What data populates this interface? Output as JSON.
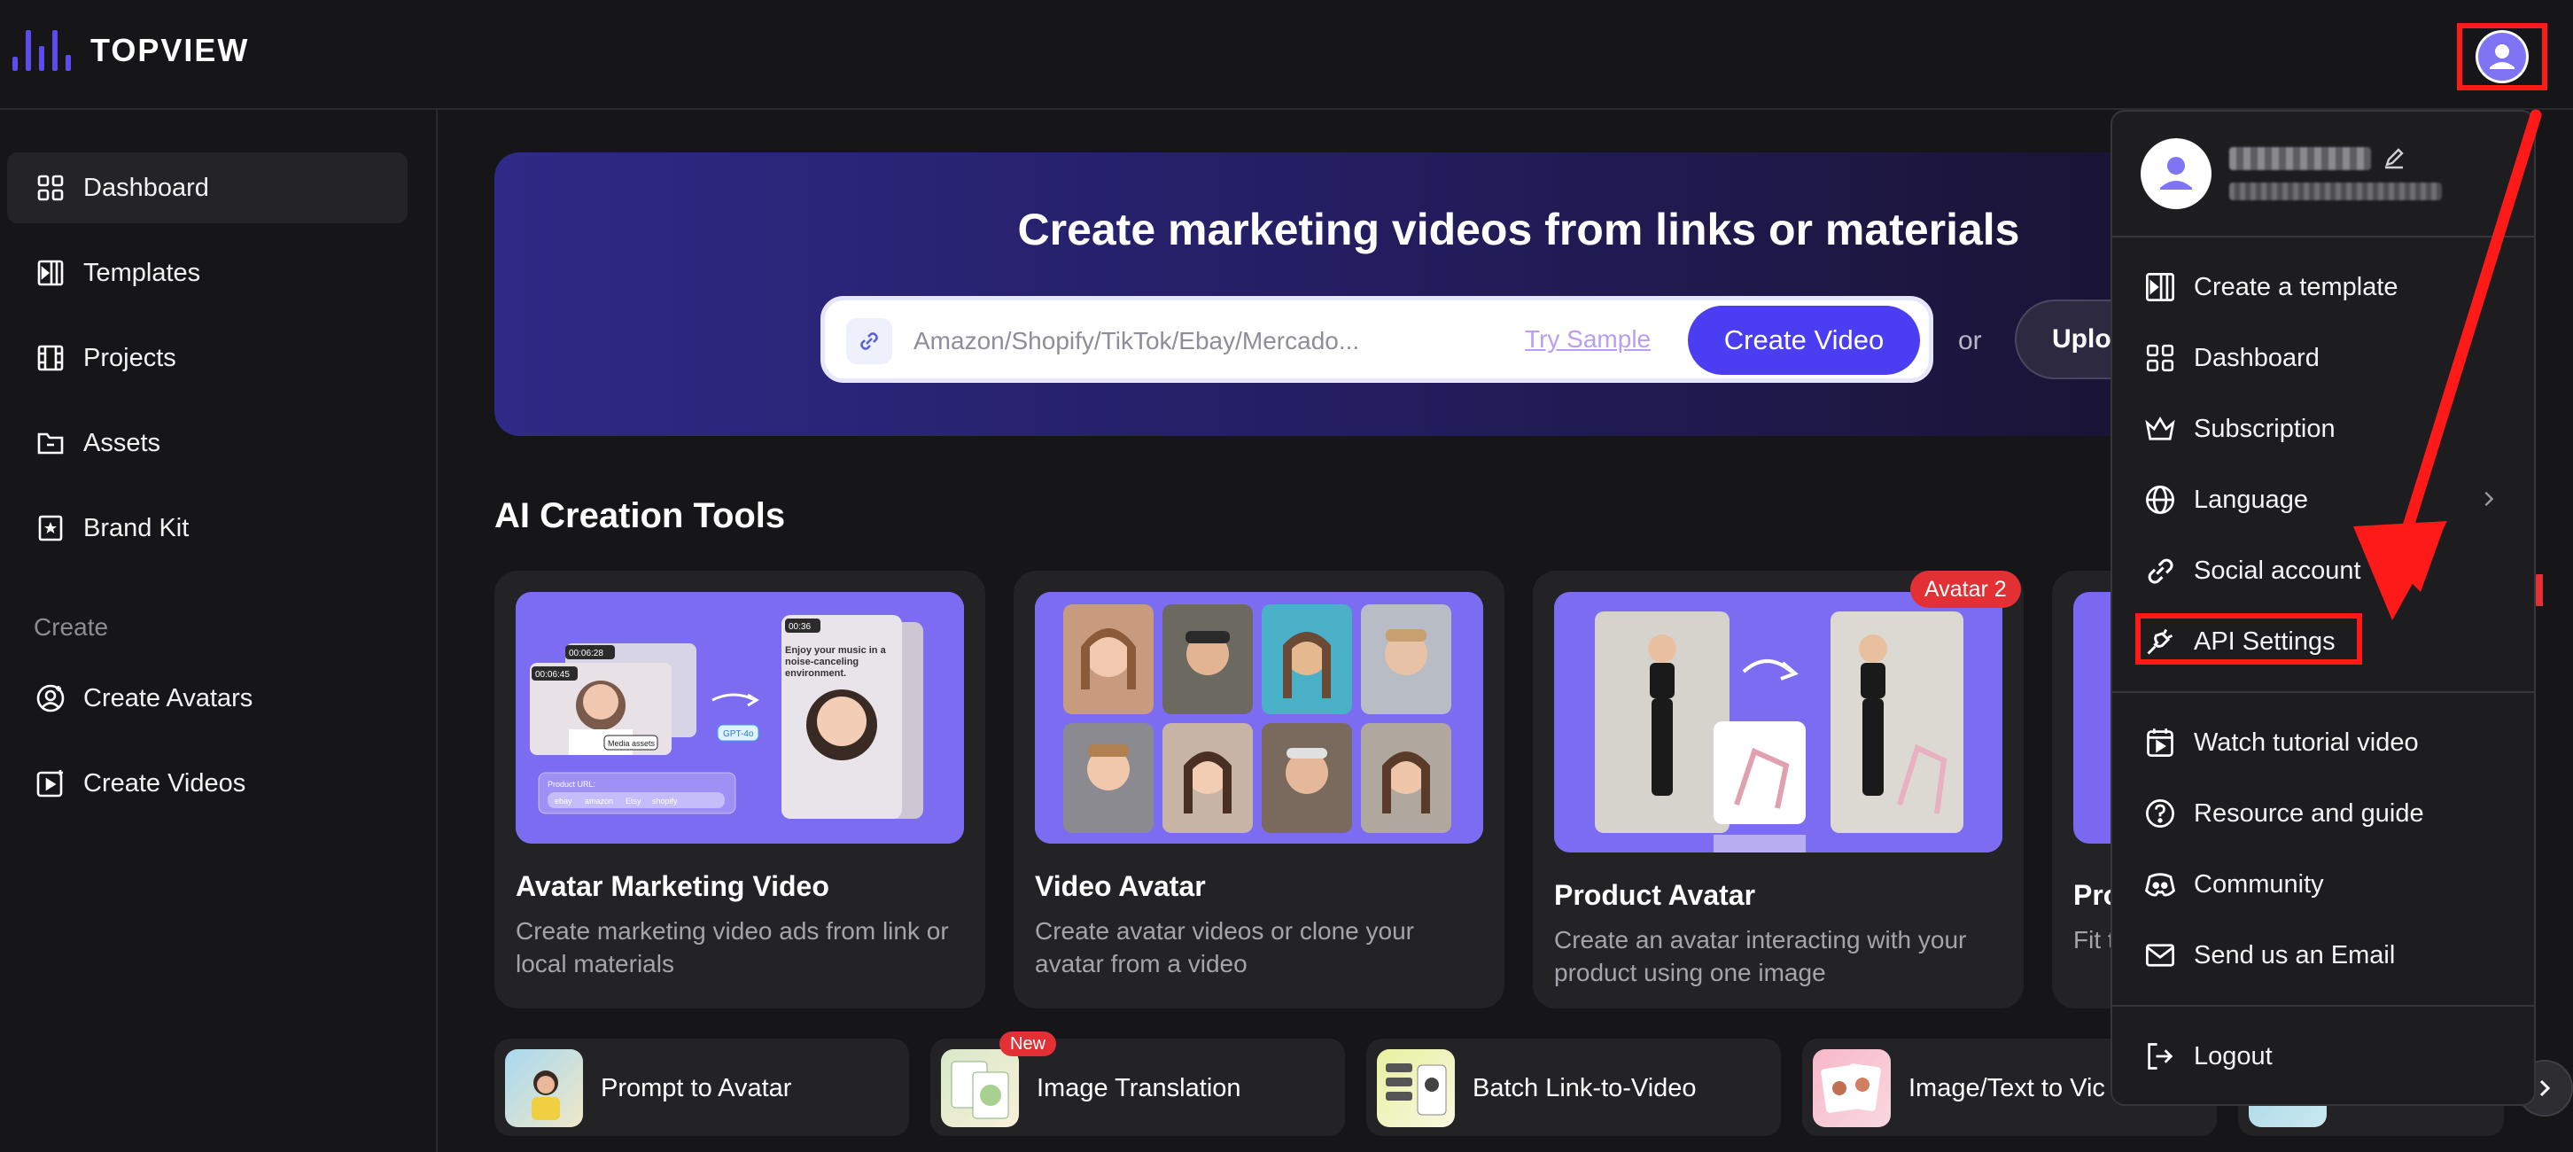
{
  "app": {
    "logo_text": "TOPVIEW"
  },
  "sidebar": {
    "items": [
      {
        "label": "Dashboard",
        "icon": "grid-icon"
      },
      {
        "label": "Templates",
        "icon": "template-icon"
      },
      {
        "label": "Projects",
        "icon": "film-icon"
      },
      {
        "label": "Assets",
        "icon": "folder-icon"
      },
      {
        "label": "Brand Kit",
        "icon": "bookmark-star-icon"
      }
    ],
    "section_create": "Create",
    "create_items": [
      {
        "label": "Create Avatars",
        "icon": "user-add-icon"
      },
      {
        "label": "Create Videos",
        "icon": "video-add-icon"
      }
    ]
  },
  "hero": {
    "title": "Create marketing videos from links or materials",
    "search_placeholder": "Amazon/Shopify/TikTok/Ebay/Mercado...",
    "try_sample": "Try Sample",
    "create_video": "Create Video",
    "or": "or",
    "upload": "Uploa"
  },
  "tools": {
    "title": "AI Creation Tools",
    "cards": [
      {
        "title": "Avatar Marketing Video",
        "desc": "Create marketing video ads from link or local materials",
        "badge": ""
      },
      {
        "title": "Video Avatar",
        "desc": "Create avatar videos or clone your avatar from a video",
        "badge": ""
      },
      {
        "title": "Product Avatar",
        "desc": "Create an avatar interacting with your product using one image",
        "badge": "Avatar 2"
      },
      {
        "title": "Pro",
        "desc": "Fit try-",
        "badge": ""
      }
    ],
    "card1_art": {
      "t1": "00:06:28",
      "t2": "00:06:45",
      "t3": "00:36",
      "bubble": "Enjoy your music in a noise-canceling environment.",
      "media": "Media assets",
      "gpt": "GPT-4o",
      "product_url": "Product URL:",
      "stores": [
        "ebay",
        "amazon",
        "Etsy",
        "shopify"
      ]
    }
  },
  "mini_tools": [
    {
      "label": "Prompt to Avatar",
      "badge": ""
    },
    {
      "label": "Image Translation",
      "badge": "New"
    },
    {
      "label": "Batch Link-to-Video",
      "badge": ""
    },
    {
      "label": "Image/Text to Vic",
      "badge": ""
    }
  ],
  "user_menu": {
    "items_top": [
      {
        "label": "Create a template",
        "icon": "template-icon"
      },
      {
        "label": "Dashboard",
        "icon": "grid-icon"
      },
      {
        "label": "Subscription",
        "icon": "crown-icon"
      },
      {
        "label": "Language",
        "icon": "globe-icon"
      },
      {
        "label": "Social account",
        "icon": "link-icon"
      },
      {
        "label": "API Settings",
        "icon": "plug-icon"
      }
    ],
    "items_help": [
      {
        "label": "Watch tutorial video",
        "icon": "calendar-play-icon"
      },
      {
        "label": "Resource and guide",
        "icon": "question-icon"
      },
      {
        "label": "Community",
        "icon": "discord-icon"
      },
      {
        "label": "Send us an Email",
        "icon": "mail-icon"
      }
    ],
    "logout": "Logout"
  },
  "colors": {
    "accent": "#4a3df2",
    "highlight": "#ff1a1a",
    "badge": "#e33034",
    "background": "#161618"
  }
}
